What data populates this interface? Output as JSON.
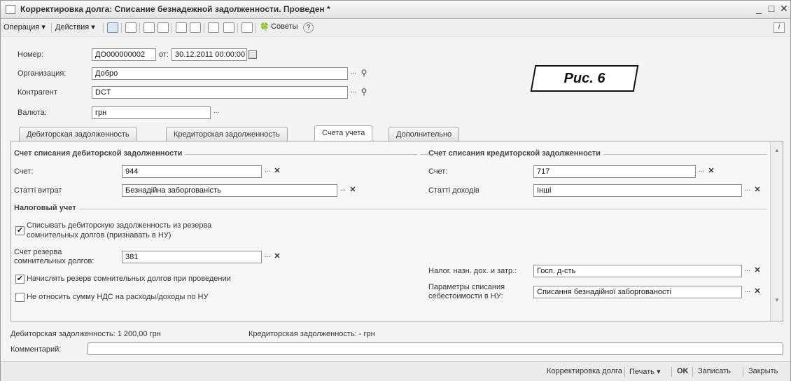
{
  "window": {
    "title": "Корректировка долга: Списание безнадежной задолженности. Проведен *",
    "minimize": "_",
    "maximize": "□",
    "close": "✕"
  },
  "toolbar": {
    "operation": "Операция ▾",
    "actions": "Действия ▾",
    "tips": "Советы",
    "help": "?",
    "info": "i",
    "tips_icon": "advice-icon"
  },
  "header": {
    "number_label": "Номер:",
    "number_value": "ДО000000002",
    "from_label": "от:",
    "date_value": "30.12.2011 00:00:00",
    "org_label": "Организация:",
    "org_value": "Добро",
    "contractor_label": "Контрагент",
    "contractor_value": "DCT",
    "currency_label": "Валюта:",
    "currency_value": "грн"
  },
  "annotation": "Рис. 6",
  "tabs": [
    {
      "label": "Дебиторская задолженность",
      "active": false
    },
    {
      "label": "Кредиторская задолженность",
      "active": false
    },
    {
      "label": "Счета учета",
      "active": true
    },
    {
      "label": "Дополнительно",
      "active": false
    }
  ],
  "debit": {
    "group_title": "Счет списания дебиторской задолженности",
    "account_label": "Счет:",
    "account_value": "944",
    "expense_label": "Статті витрат",
    "expense_value": "Безнадійна заборгованість"
  },
  "credit": {
    "group_title": "Счет списания кредиторской задолженности",
    "account_label": "Счет:",
    "account_value": "717",
    "income_label": "Статті доходів",
    "income_value": "Інші"
  },
  "tax": {
    "group_title": "Налоговый учет",
    "writeoff_reserve_line1": "Списывать дебиторскую задолженность из резерва",
    "writeoff_reserve_line2": "сомнительных долгов (признавать в НУ)",
    "writeoff_reserve_checked": true,
    "reserve_account_label_1": "Счет резерва",
    "reserve_account_label_2": "сомнительных долгов:",
    "reserve_account_value": "381",
    "accrue_reserve_label": "Начислять резерв сомнительных долгов при проведении",
    "accrue_reserve_checked": true,
    "vat_label": "Не относить сумму НДС на расходы/доходы по НУ",
    "vat_checked": false,
    "purpose_label": "Налог. назн. дох. и затр.:",
    "purpose_value": "Госп. д-сть",
    "cost_params_label_1": "Параметры списания",
    "cost_params_label_2": "себестоимости в НУ:",
    "cost_params_value": "Списання безнадійної заборгованості"
  },
  "totals": {
    "debit_total": "Дебиторская задолженность: 1 200,00 грн",
    "credit_total": "Кредиторская задолженность: - грн"
  },
  "comment": {
    "label": "Комментарий:",
    "value": ""
  },
  "statusbar": {
    "adjust": "Корректировка долга",
    "print": "Печать ▾",
    "ok": "OK",
    "save": "Записать",
    "close": "Закрыть"
  },
  "buttons": {
    "dots": "...",
    "clear": "✕",
    "search": "🔍"
  }
}
